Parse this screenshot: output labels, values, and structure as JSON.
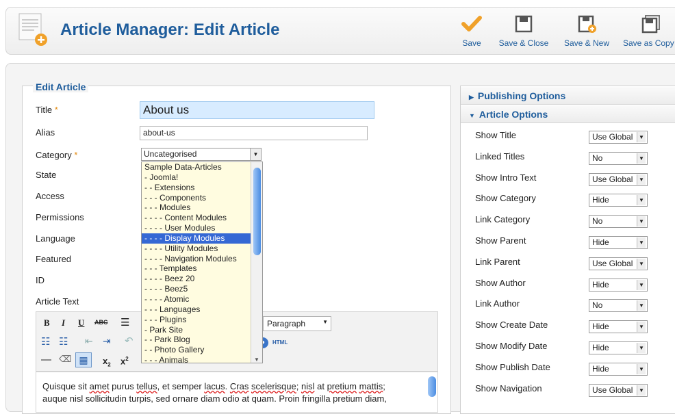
{
  "header": {
    "title": "Article Manager: Edit Article",
    "toolbar": [
      {
        "label": "Save",
        "icon": "checkmark-icon"
      },
      {
        "label": "Save & Close",
        "icon": "save-close-icon"
      },
      {
        "label": "Save & New",
        "icon": "save-new-icon"
      },
      {
        "label": "Save as Copy",
        "icon": "save-copy-icon"
      }
    ]
  },
  "edit": {
    "legend": "Edit Article",
    "fields": {
      "title_label": "Title",
      "title_value": "About us",
      "alias_label": "Alias",
      "alias_value": "about-us",
      "category_label": "Category",
      "category_value": "Uncategorised",
      "state_label": "State",
      "access_label": "Access",
      "permissions_label": "Permissions",
      "language_label": "Language",
      "featured_label": "Featured",
      "id_label": "ID",
      "article_text_label": "Article Text",
      "required_mark": "*"
    },
    "category_options": [
      "Sample Data-Articles",
      "- Joomla!",
      "- - Extensions",
      "- - - Components",
      "- - - Modules",
      "- - - - Content Modules",
      "- - - - User Modules",
      "- - - - Display Modules",
      "- - - - Utility Modules",
      "- - - - Navigation Modules",
      "- - - Templates",
      "- - - - Beez 20",
      "- - - - Beez5",
      "- - - - Atomic",
      "- - - Languages",
      "- - - Plugins",
      "- Park Site",
      "- - Park Blog",
      "- - Photo Gallery",
      "- - - Animals"
    ],
    "category_selected_index": 7,
    "editor": {
      "format_value": "Paragraph",
      "html_label": "HTML",
      "text_line1_a": "Quisque sit ",
      "text_line1_b": "amet",
      "text_line1_c": " purus ",
      "text_line1_d": "tellus",
      "text_line1_e": ", et semper ",
      "text_line1_f": "lacus",
      "text_line1_g": ". ",
      "text_line1_h": "Cras",
      "text_line1_i": " ",
      "text_line1_j": "scelerisque",
      "text_line1_k": "; ",
      "text_line1_l": "nisl",
      "text_line1_m": " at ",
      "text_line1_n": "pretium",
      "text_line1_o": " ",
      "text_line1_p": "mattis",
      "text_line1_q": ";",
      "text_line2": "auque nisl sollicitudin turpis, sed ornare diam odio at quam. Proin fringilla pretium diam,"
    }
  },
  "options": {
    "publishing_header": "Publishing Options",
    "article_header": "Article Options",
    "rows": [
      {
        "label": "Show Title",
        "value": "Use Global"
      },
      {
        "label": "Linked Titles",
        "value": "No"
      },
      {
        "label": "Show Intro Text",
        "value": "Use Global"
      },
      {
        "label": "Show Category",
        "value": "Hide"
      },
      {
        "label": "Link Category",
        "value": "No"
      },
      {
        "label": "Show Parent",
        "value": "Hide"
      },
      {
        "label": "Link Parent",
        "value": "Use Global"
      },
      {
        "label": "Show Author",
        "value": "Hide"
      },
      {
        "label": "Link Author",
        "value": "No"
      },
      {
        "label": "Show Create Date",
        "value": "Hide"
      },
      {
        "label": "Show Modify Date",
        "value": "Hide"
      },
      {
        "label": "Show Publish Date",
        "value": "Hide"
      },
      {
        "label": "Show Navigation",
        "value": "Use Global"
      }
    ]
  },
  "colors": {
    "brand_blue": "#1f5d9c",
    "accent_orange": "#f0a12a",
    "selection_blue": "#3568d4",
    "title_input_bg": "#d8ecff",
    "dropdown_bg": "#fffce0"
  }
}
